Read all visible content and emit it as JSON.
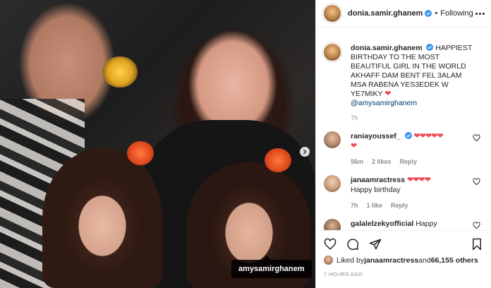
{
  "post": {
    "photo_alt": "",
    "tag_label": "amysamirghanem"
  },
  "header": {
    "username": "donia.samir.ghanem",
    "separator": "•",
    "follow_label": "Following"
  },
  "caption": {
    "username": "donia.samir.ghanem",
    "text_line1": " HAPPIEST BIRTHDAY TO THE MOST BEAUTIFUL GIRL IN THE WORLD",
    "text_line2": "AKHAFF DAM BENT FEL 3ALAM MSA RABENA YES3EDEK W YE7MIKY ",
    "heart": "❤",
    "mention": "@amysamirghanem",
    "time": "7h"
  },
  "comments": [
    {
      "username": "raniayoussef_",
      "text": "❤❤❤❤❤",
      "text2": "❤",
      "time": "56m",
      "likes": "2 likes",
      "reply": "Reply"
    },
    {
      "username": "janaamractress",
      "text": "❤❤❤❤",
      "text2": "Happy birthday",
      "time": "7h",
      "likes": "1 like",
      "reply": "Reply"
    },
    {
      "username": "galalelzekyofficial",
      "text": "Happy",
      "text2": ""
    }
  ],
  "likes": {
    "prefix": "Liked by ",
    "user": "janaamractress",
    "middle": " and ",
    "others": "66,155 others"
  },
  "posted": "7 HOURS AGO",
  "colors": {
    "accent": "#0095f6",
    "heart": "#ed4956",
    "mention": "#00376b",
    "muted": "#8e8e8e"
  }
}
